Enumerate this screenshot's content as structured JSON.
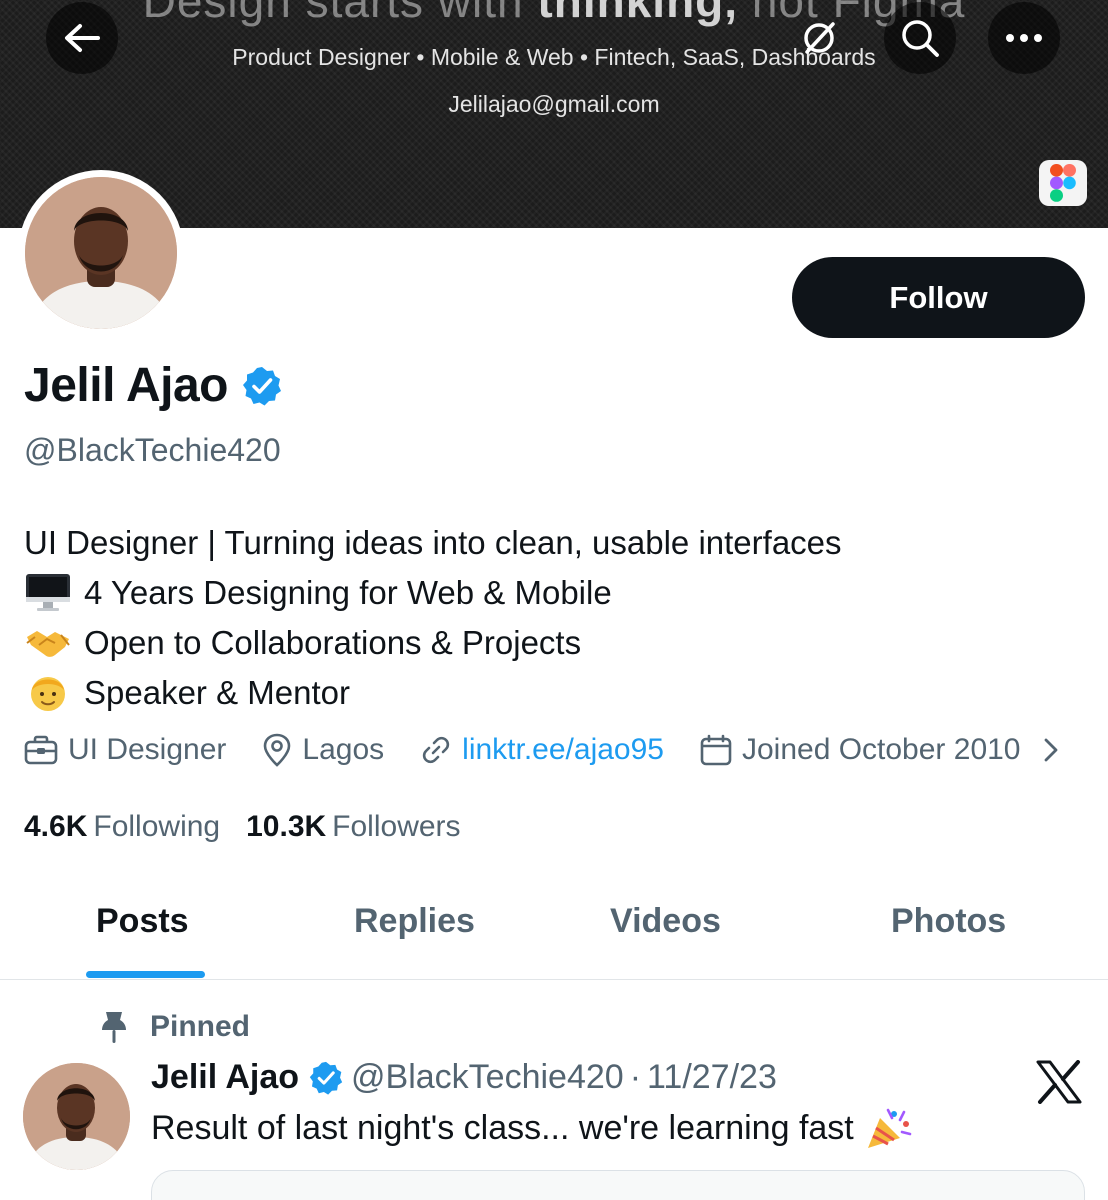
{
  "banner": {
    "headline_plain": "Design starts with ",
    "headline_bold": "thinking,",
    "headline_tail": " not Figma",
    "subtitle": "Product Designer • Mobile & Web • Fintech, SaaS, Dashboards",
    "email": "Jelilajao@gmail.com"
  },
  "nav": {
    "back_icon": "arrow-left-icon",
    "grok_icon": "grok-icon",
    "search_icon": "search-icon",
    "more_icon": "more-dots-icon"
  },
  "profile": {
    "display_name": "Jelil Ajao",
    "handle": "@BlackTechie420",
    "follow_label": "Follow",
    "bio": [
      {
        "emoji": "desktop-computer-icon",
        "text": "UI Designer | Turning ideas into clean, usable interfaces"
      },
      {
        "emoji": "desktop-computer-icon",
        "text": "4 Years Designing for Web & Mobile"
      },
      {
        "emoji": "handshake-icon",
        "text": "Open to Collaborations & Projects"
      },
      {
        "emoji": "person-icon",
        "text": "Speaker & Mentor"
      }
    ],
    "meta": {
      "profession": "UI Designer",
      "location": "Lagos",
      "link": "linktr.ee/ajao95",
      "joined": "Joined October 2010"
    },
    "stats": {
      "following_count": "4.6K",
      "following_label": "Following",
      "followers_count": "10.3K",
      "followers_label": "Followers"
    }
  },
  "tabs": [
    "Posts",
    "Replies",
    "Videos",
    "Photos"
  ],
  "active_tab": "Posts",
  "pinned_post": {
    "pinned_label": "Pinned",
    "author": "Jelil Ajao",
    "handle": "@BlackTechie420",
    "separator": "·",
    "date": "11/27/23",
    "text": "Result of last night's class... we're learning fast"
  },
  "colors": {
    "accent": "#1d9bf0",
    "text": "#0f1419",
    "muted": "#536471",
    "follow_bg": "#0f1419"
  }
}
